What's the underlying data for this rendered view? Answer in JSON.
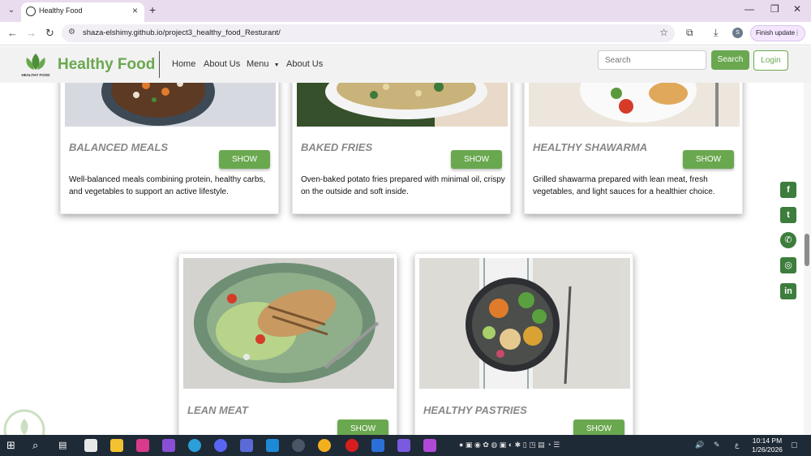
{
  "browser": {
    "tab_title": "Healthy Food",
    "url": "shaza-elshimy.github.io/project3_healthy_food_Resturant/",
    "profile_initial": "S",
    "finish_update_label": "Finish update"
  },
  "site": {
    "brand": "Healthy Food",
    "logo_text": "HEALTHY FOOD",
    "nav": [
      "Home",
      "About Us",
      "Menu",
      "About Us"
    ],
    "search_placeholder": "Search",
    "search_button": "Search",
    "login_button": "Login",
    "accent": "#6aa84f"
  },
  "cards": [
    {
      "title": "BALANCED MEALS",
      "button": "SHOW",
      "desc": "Well-balanced meals combining protein, healthy carbs, and vegetables to support an active lifestyle."
    },
    {
      "title": "BAKED FRIES",
      "button": "SHOW",
      "desc": "Oven-baked potato fries prepared with minimal oil, crispy on the outside and soft inside."
    },
    {
      "title": "HEALTHY SHAWARMA",
      "button": "SHOW",
      "desc": "Grilled shawarma prepared with lean meat, fresh vegetables, and light sauces for a healthier choice."
    },
    {
      "title": "LEAN MEAT",
      "button": "SHOW",
      "desc": ""
    },
    {
      "title": "HEALTHY PASTRIES",
      "button": "SHOW",
      "desc": ""
    }
  ],
  "social_icons": [
    "facebook-icon",
    "twitter-icon",
    "whatsapp-icon",
    "instagram-icon",
    "linkedin-icon"
  ],
  "taskbar": {
    "time": "10:14 PM",
    "date": "1/26/2026"
  }
}
